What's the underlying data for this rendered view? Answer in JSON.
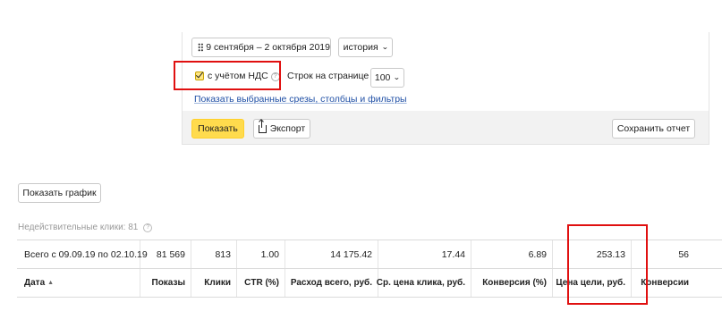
{
  "panel": {
    "date_range": "9 сентября – 2 октября 2019",
    "history_label": "история",
    "vat_checkbox": {
      "label": "с учётом НДС",
      "checked": true
    },
    "rows_per_page_label": "Строк на странице",
    "rows_per_page_value": "100",
    "selected_slices_link": "Показать выбранные срезы, столбцы и фильтры",
    "show_button": "Показать",
    "export_button": "Экспорт",
    "save_report_button": "Сохранить отчет"
  },
  "show_chart_button": "Показать график",
  "invalid_clicks": "Недействительные клики: 81",
  "table": {
    "total_row": [
      "Всего с 09.09.19 по 02.10.19",
      "81 569",
      "813",
      "1.00",
      "14 175.42",
      "17.44",
      "6.89",
      "253.13",
      "56"
    ],
    "headers": [
      "Дата",
      "Показы",
      "Клики",
      "CTR (%)",
      "Расход всего, руб.",
      "Ср. цена клика, руб.",
      "Конверсия (%)",
      "Цена цели, руб.",
      "Конверсии"
    ],
    "sort_indicator": "▲"
  },
  "colors": {
    "primary_button": "#ffdb4d",
    "highlight": "#e01010",
    "link": "#1f4fa5"
  },
  "icons": [
    "calendar-icon",
    "chevron-down-icon",
    "help-icon",
    "export-icon",
    "sort-asc-icon"
  ]
}
